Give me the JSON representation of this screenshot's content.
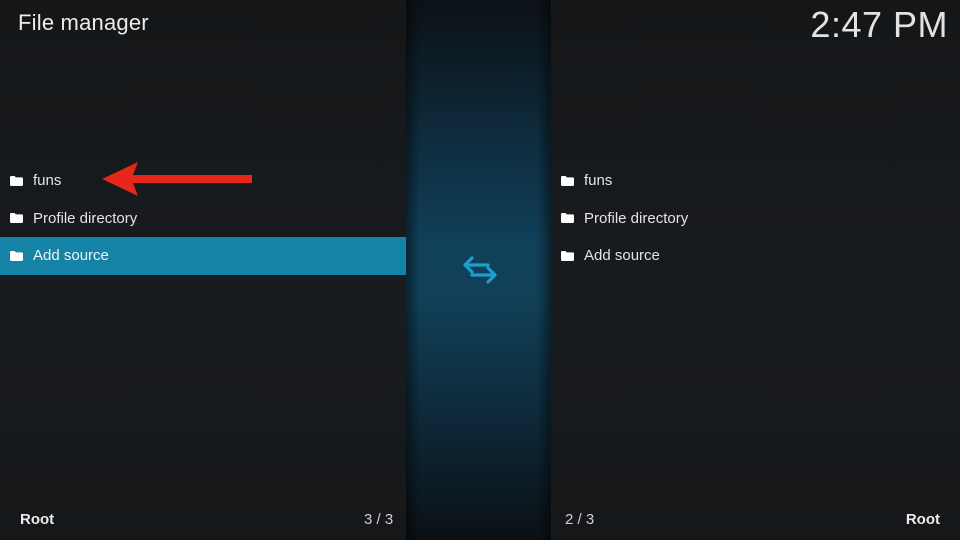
{
  "header": {
    "title": "File manager",
    "clock": "2:47 PM"
  },
  "left_pane": {
    "items": [
      {
        "label": "funs",
        "icon": "folder-icon"
      },
      {
        "label": "Profile directory",
        "icon": "folder-icon"
      },
      {
        "label": "Add source",
        "icon": "folder-icon",
        "selected": true
      }
    ],
    "footer_label": "Root",
    "footer_count": "3 / 3"
  },
  "right_pane": {
    "items": [
      {
        "label": "funs",
        "icon": "folder-icon"
      },
      {
        "label": "Profile directory",
        "icon": "folder-icon"
      },
      {
        "label": "Add source",
        "icon": "folder-icon"
      }
    ],
    "footer_label": "Root",
    "footer_count": "2 / 3"
  },
  "center": {
    "icon": "swap-arrows-icon"
  },
  "annotation": {
    "icon": "red-arrow-icon",
    "color": "#e8271b"
  },
  "colors": {
    "selection": "#1483a6",
    "accent": "#1a9fcf"
  }
}
